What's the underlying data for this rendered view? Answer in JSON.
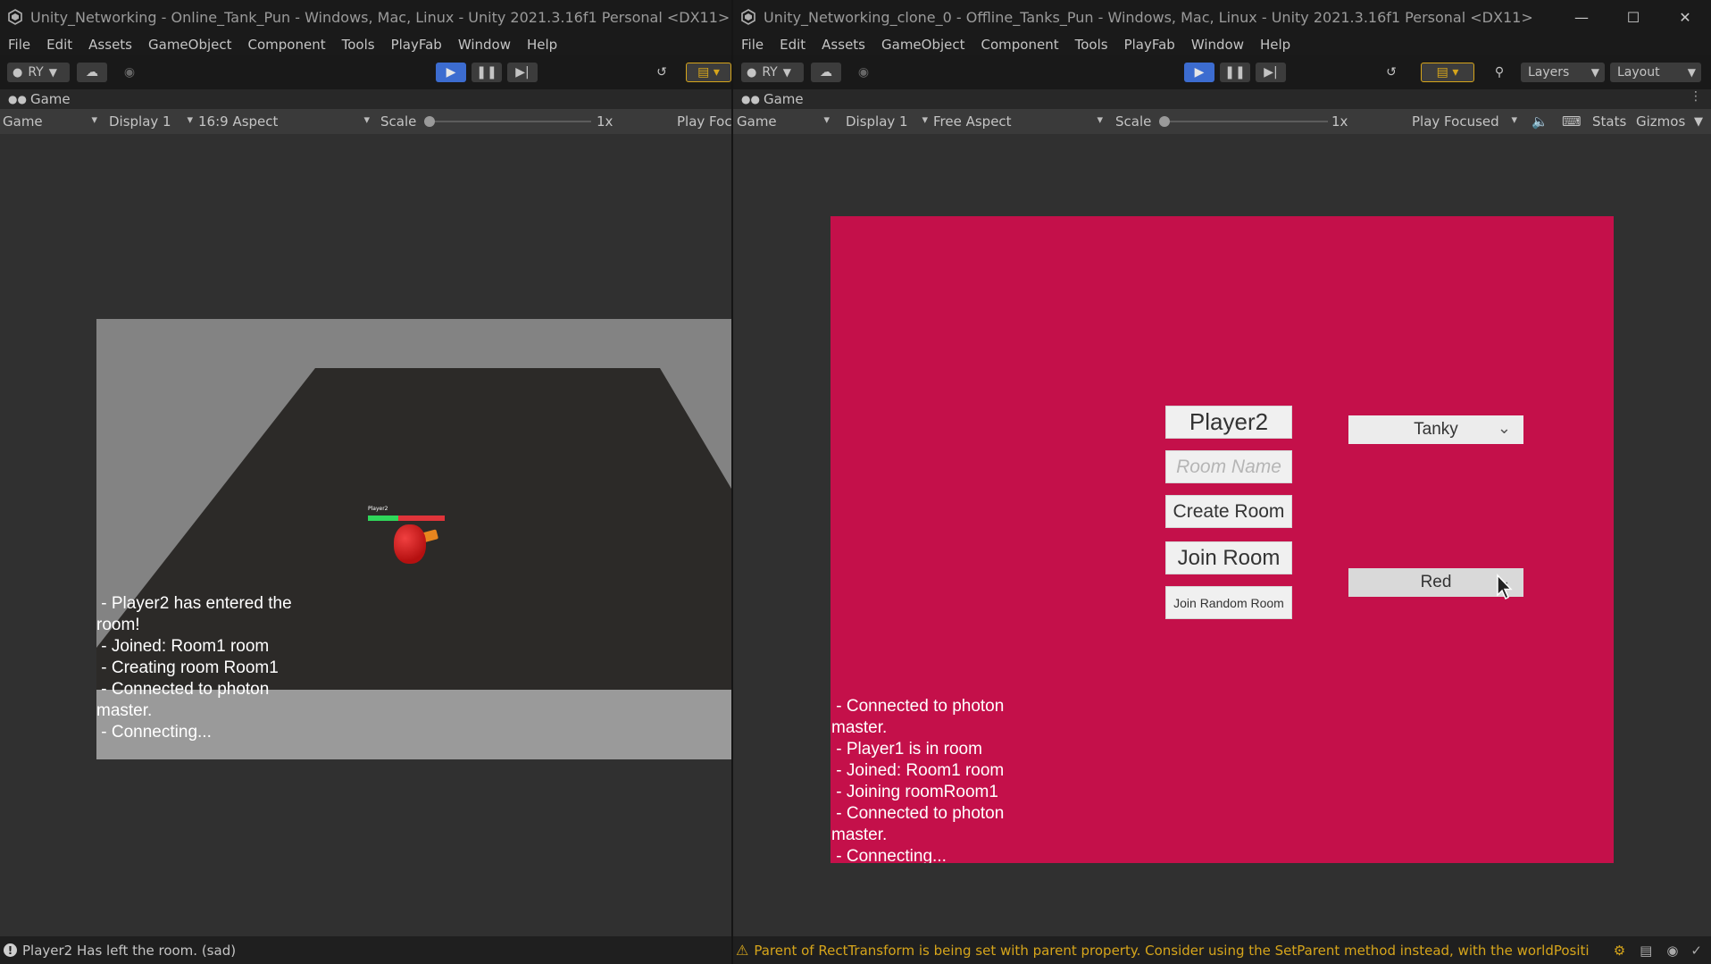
{
  "left_window": {
    "title": "Unity_Networking - Online_Tank_Pun - Windows, Mac, Linux - Unity 2021.3.16f1 Personal <DX11>",
    "menu": [
      "File",
      "Edit",
      "Assets",
      "GameObject",
      "Component",
      "Tools",
      "PlayFab",
      "Window",
      "Help"
    ],
    "account_label": "RY",
    "tab_label": "Game",
    "game_toolbar": {
      "mode": "Game",
      "display": "Display 1",
      "aspect": "16:9 Aspect",
      "scale_label": "Scale",
      "scale_value": "1x",
      "play_mode": "Play Foc"
    },
    "scene": {
      "player_tag": "Player2",
      "health_fraction": 0.4,
      "log": [
        " - Player2 has entered the room!",
        " - Joined: Room1 room",
        " - Creating room Room1",
        " - Connected to photon master.",
        " - Connecting..."
      ]
    },
    "status_message": "Player2 Has left the room. (sad)"
  },
  "right_window": {
    "title": "Unity_Networking_clone_0 - Offline_Tanks_Pun - Windows, Mac, Linux - Unity 2021.3.16f1 Personal <DX11>",
    "menu": [
      "File",
      "Edit",
      "Assets",
      "GameObject",
      "Component",
      "Tools",
      "PlayFab",
      "Window",
      "Help"
    ],
    "account_label": "RY",
    "layers_label": "Layers",
    "layout_label": "Layout",
    "tab_label": "Game",
    "game_toolbar": {
      "mode": "Game",
      "display": "Display 1",
      "aspect": "Free Aspect",
      "scale_label": "Scale",
      "scale_value": "1x",
      "play_mode": "Play Focused",
      "stats": "Stats",
      "gizmos": "Gizmos"
    },
    "lobby": {
      "player_name": "Player2",
      "room_name_placeholder": "Room Name",
      "create_room": "Create Room",
      "join_room": "Join Room",
      "join_random_room": "Join Random Room",
      "tank_select": "Tanky",
      "color_select": "Red",
      "log": [
        " - Connected to photon master.",
        " - Player1 is in room",
        " - Joined: Room1 room",
        " - Joining roomRoom1",
        " - Connected to photon master.",
        " - Connecting..."
      ],
      "background_color": "#c4104a"
    },
    "status_message": "Parent of RectTransform is being set with parent property. Consider using the SetParent method instead, with the worldPositi"
  },
  "colors": {
    "play_active": "#3c6cd0",
    "warning": "#d6a51b",
    "health": "#2fd65a",
    "health_missing": "#e0343a",
    "tank_body": "#cc1b1b",
    "tank_barrel": "#e8851e"
  }
}
